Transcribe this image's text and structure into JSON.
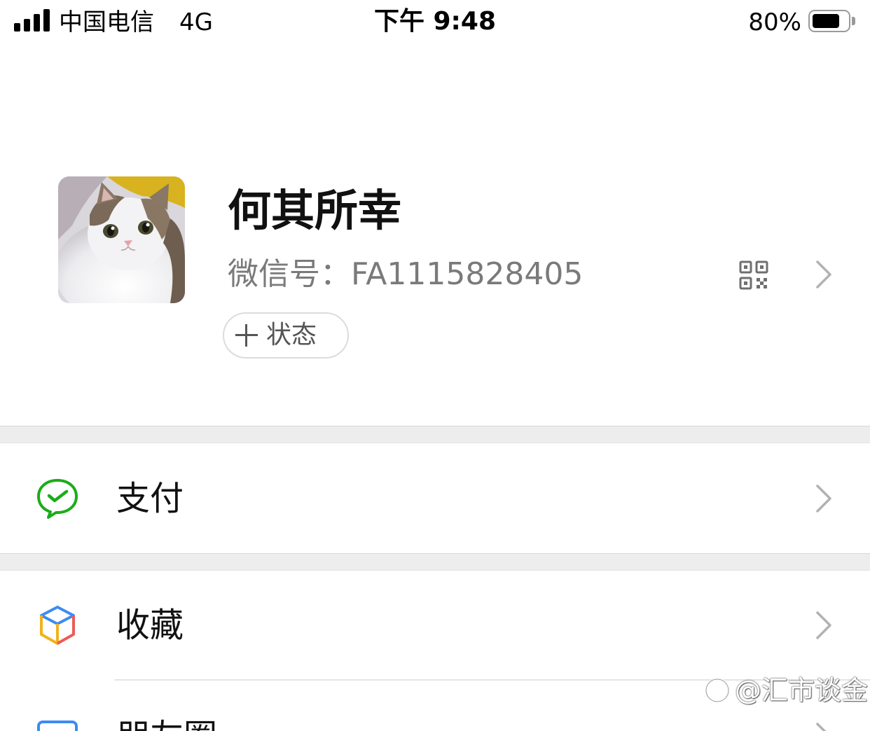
{
  "status_bar": {
    "carrier": "中国电信",
    "network": "4G",
    "time": "下午 9:48",
    "battery_percent": "80%",
    "battery_level": 0.8,
    "signal_bars": 4
  },
  "profile": {
    "name": "何其所幸",
    "wechat_id": "微信号：FA1115828405",
    "status_button_label": "状态"
  },
  "menu": {
    "items": [
      {
        "label": "支付",
        "icon": "wechat-pay-icon"
      },
      {
        "label": "收藏",
        "icon": "favorites-cube-icon"
      },
      {
        "label": "朋友圈",
        "icon": "moments-icon"
      }
    ]
  },
  "watermark": {
    "text": "@汇市谈金"
  },
  "colors": {
    "pay_green": "#1AAD19",
    "chevron_gray": "#B2B2B2",
    "separator_gray": "#EDEDED",
    "secondary_text": "#7A7A7A"
  }
}
